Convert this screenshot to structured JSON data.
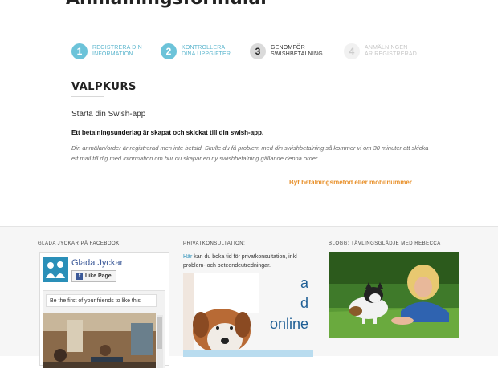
{
  "page": {
    "title": "Anmälningsformulär"
  },
  "steps": [
    {
      "number": "1",
      "label": "Registrera din\ninformation",
      "state": "done"
    },
    {
      "number": "2",
      "label": "Kontrollera\ndina uppgifter",
      "state": "done"
    },
    {
      "number": "3",
      "label": "Genomför\nswishbetalning",
      "state": "active"
    },
    {
      "number": "4",
      "label": "Anmälningen\när registrerad",
      "state": "pending"
    }
  ],
  "order": {
    "title": "VALPKURS",
    "swish_start": "Starta din Swish-app",
    "invoice_created": "Ett betalningsunderlag är skapat och skickat till din swish-app.",
    "info_text": "Din anmälan/order är registrerad men inte betald. Skulle du få problem med din swishbetalning så kommer vi om 30 minuter att skicka ett mail till dig med information om hur du skapar en ny swishbetalning gällande denna order.",
    "change_link": "Byt betalningsmetod eller mobilnummer"
  },
  "footer": {
    "facebook": {
      "heading": "GLADA JYCKAR PÅ FACEBOOK:",
      "page_name": "Glada Jyckar",
      "like_label": "Like Page",
      "friends_text": "Be the first of your friends to like this"
    },
    "consult": {
      "heading": "PRIVATKONSULTATION:",
      "link_text": "Här",
      "text": " kan du boka tid för privatkonsultation, inkl problem- och beteendeutredningar.",
      "image_text": [
        "a",
        "d",
        "online"
      ]
    },
    "blog": {
      "heading": "BLOGG: TÄVLINGSGLÄDJE MED REBECCA"
    }
  },
  "colors": {
    "step_done": "#6cc3d9",
    "link_orange": "#e8902a",
    "facebook_blue": "#3b5998",
    "link_blue": "#2a8fb8"
  }
}
